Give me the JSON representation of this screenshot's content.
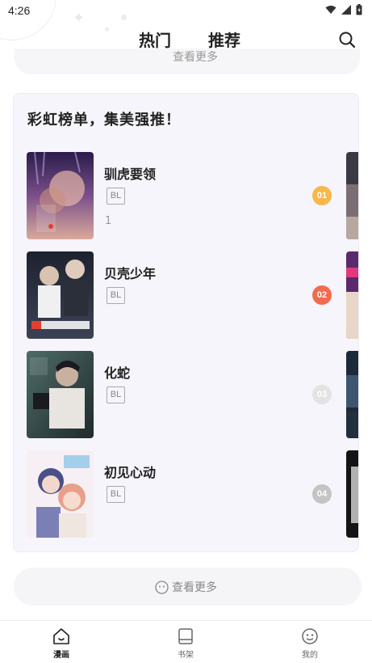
{
  "status_bar": {
    "time": "4:26",
    "icons": [
      "wifi-icon",
      "signal-icon",
      "battery-icon"
    ]
  },
  "header": {
    "tabs": [
      {
        "label": "热门",
        "active": false
      },
      {
        "label": "推荐",
        "active": true
      }
    ],
    "search_icon": "search-icon"
  },
  "previous_section": {
    "more_label": "查看更多"
  },
  "ranking": {
    "title": "彩虹榜单，集美强推！",
    "items": [
      {
        "rank": "01",
        "title": "驯虎要领",
        "tag": "BL",
        "extra": "1",
        "badge_color": "#f7b84b"
      },
      {
        "rank": "02",
        "title": "贝壳少年",
        "tag": "BL",
        "extra": "",
        "badge_color": "#f46a4f"
      },
      {
        "rank": "03",
        "title": "化蛇",
        "tag": "BL",
        "extra": "",
        "badge_color": "#e3e3e3"
      },
      {
        "rank": "04",
        "title": "初见心动",
        "tag": "BL",
        "extra": "",
        "badge_color": "#c4c4c4"
      }
    ]
  },
  "more_button": {
    "label": "查看更多",
    "icon": "smile-icon"
  },
  "bottom_nav": {
    "items": [
      {
        "label": "漫画",
        "icon": "home-icon",
        "active": true
      },
      {
        "label": "书架",
        "icon": "book-icon",
        "active": false
      },
      {
        "label": "我的",
        "icon": "profile-icon",
        "active": false
      }
    ]
  },
  "colors": {
    "accent": "#222222",
    "card_bg": "#f5f5fb",
    "rank1": "#f7b84b",
    "rank2": "#f46a4f",
    "rank3": "#e3e3e3",
    "rank4": "#c4c4c4"
  }
}
